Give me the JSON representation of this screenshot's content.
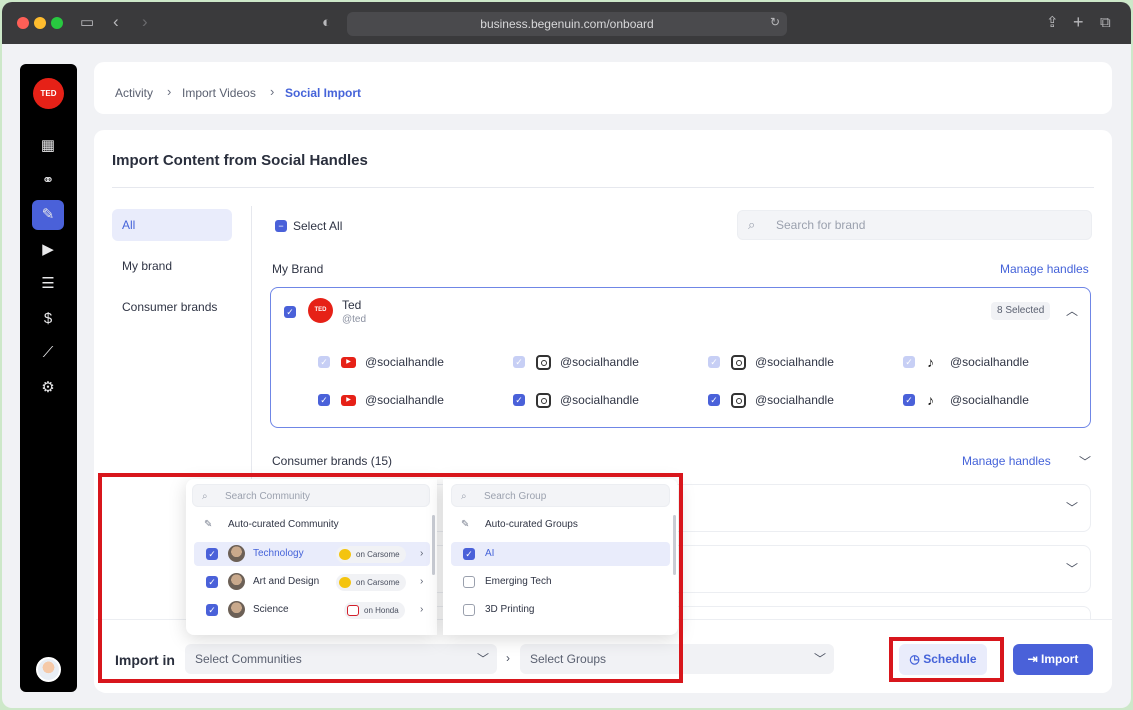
{
  "browser": {
    "url": "business.begenuin.com/onboard"
  },
  "sidebar": {
    "logo_text": "TED",
    "icons": [
      "grid-icon",
      "community-icon",
      "magic-wand-icon",
      "video-import-icon",
      "checklist-icon",
      "dollar-icon",
      "analytics-icon",
      "settings-icon"
    ],
    "active_index": 2
  },
  "breadcrumb": {
    "items": [
      "Activity",
      "Import Videos",
      "Social Import"
    ]
  },
  "main": {
    "title": "Import Content from Social Handles",
    "left_nav": [
      "All",
      "My brand",
      "Consumer brands"
    ],
    "select_all": "Select All",
    "search_brand_placeholder": "Search for brand",
    "my_brand_label": "My Brand",
    "manage_handles": "Manage handles",
    "brand": {
      "name": "Ted",
      "handle": "@ted",
      "avatar_text": "TED",
      "selected_badge": "8 Selected"
    },
    "handles_row1": [
      {
        "platform": "youtube",
        "handle": "@socialhandle"
      },
      {
        "platform": "instagram",
        "handle": "@socialhandle"
      },
      {
        "platform": "instagram",
        "handle": "@socialhandle"
      },
      {
        "platform": "tiktok",
        "handle": "@socialhandle"
      }
    ],
    "handles_row2": [
      {
        "platform": "youtube",
        "handle": "@socialhandle"
      },
      {
        "platform": "instagram",
        "handle": "@socialhandle"
      },
      {
        "platform": "instagram",
        "handle": "@socialhandle"
      },
      {
        "platform": "tiktok",
        "handle": "@socialhandle"
      }
    ],
    "consumer_brands_label": "Consumer brands (15)",
    "consumer_manage_handles": "Manage handles"
  },
  "import_bar": {
    "label": "Import in",
    "communities_placeholder": "Select Communities",
    "groups_placeholder": "Select Groups",
    "schedule_label": "Schedule",
    "import_label": "Import"
  },
  "community_dropdown": {
    "search_placeholder": "Search Community",
    "auto_label": "Auto-curated Community",
    "items": [
      {
        "name": "Technology",
        "brand": "on Carsome"
      },
      {
        "name": "Art and Design",
        "brand": "on Carsome"
      },
      {
        "name": "Science",
        "brand": "on Honda"
      }
    ]
  },
  "group_dropdown": {
    "search_placeholder": "Search Group",
    "auto_label": "Auto-curated Groups",
    "items": [
      "AI",
      "Emerging Tech",
      "3D Printing"
    ]
  },
  "colors": {
    "accent": "#4a61d9",
    "highlight_box": "#d8161c",
    "ted_red": "#e62117"
  }
}
